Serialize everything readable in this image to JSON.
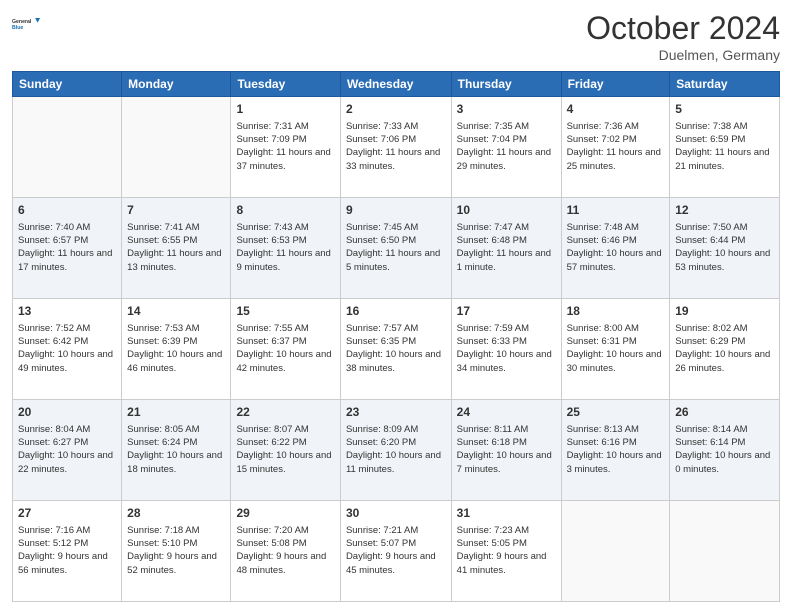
{
  "header": {
    "logo_line1": "General",
    "logo_line2": "Blue",
    "month": "October 2024",
    "location": "Duelmen, Germany"
  },
  "days_of_week": [
    "Sunday",
    "Monday",
    "Tuesday",
    "Wednesday",
    "Thursday",
    "Friday",
    "Saturday"
  ],
  "weeks": [
    [
      {
        "day": "",
        "info": ""
      },
      {
        "day": "",
        "info": ""
      },
      {
        "day": "1",
        "info": "Sunrise: 7:31 AM\nSunset: 7:09 PM\nDaylight: 11 hours and 37 minutes."
      },
      {
        "day": "2",
        "info": "Sunrise: 7:33 AM\nSunset: 7:06 PM\nDaylight: 11 hours and 33 minutes."
      },
      {
        "day": "3",
        "info": "Sunrise: 7:35 AM\nSunset: 7:04 PM\nDaylight: 11 hours and 29 minutes."
      },
      {
        "day": "4",
        "info": "Sunrise: 7:36 AM\nSunset: 7:02 PM\nDaylight: 11 hours and 25 minutes."
      },
      {
        "day": "5",
        "info": "Sunrise: 7:38 AM\nSunset: 6:59 PM\nDaylight: 11 hours and 21 minutes."
      }
    ],
    [
      {
        "day": "6",
        "info": "Sunrise: 7:40 AM\nSunset: 6:57 PM\nDaylight: 11 hours and 17 minutes."
      },
      {
        "day": "7",
        "info": "Sunrise: 7:41 AM\nSunset: 6:55 PM\nDaylight: 11 hours and 13 minutes."
      },
      {
        "day": "8",
        "info": "Sunrise: 7:43 AM\nSunset: 6:53 PM\nDaylight: 11 hours and 9 minutes."
      },
      {
        "day": "9",
        "info": "Sunrise: 7:45 AM\nSunset: 6:50 PM\nDaylight: 11 hours and 5 minutes."
      },
      {
        "day": "10",
        "info": "Sunrise: 7:47 AM\nSunset: 6:48 PM\nDaylight: 11 hours and 1 minute."
      },
      {
        "day": "11",
        "info": "Sunrise: 7:48 AM\nSunset: 6:46 PM\nDaylight: 10 hours and 57 minutes."
      },
      {
        "day": "12",
        "info": "Sunrise: 7:50 AM\nSunset: 6:44 PM\nDaylight: 10 hours and 53 minutes."
      }
    ],
    [
      {
        "day": "13",
        "info": "Sunrise: 7:52 AM\nSunset: 6:42 PM\nDaylight: 10 hours and 49 minutes."
      },
      {
        "day": "14",
        "info": "Sunrise: 7:53 AM\nSunset: 6:39 PM\nDaylight: 10 hours and 46 minutes."
      },
      {
        "day": "15",
        "info": "Sunrise: 7:55 AM\nSunset: 6:37 PM\nDaylight: 10 hours and 42 minutes."
      },
      {
        "day": "16",
        "info": "Sunrise: 7:57 AM\nSunset: 6:35 PM\nDaylight: 10 hours and 38 minutes."
      },
      {
        "day": "17",
        "info": "Sunrise: 7:59 AM\nSunset: 6:33 PM\nDaylight: 10 hours and 34 minutes."
      },
      {
        "day": "18",
        "info": "Sunrise: 8:00 AM\nSunset: 6:31 PM\nDaylight: 10 hours and 30 minutes."
      },
      {
        "day": "19",
        "info": "Sunrise: 8:02 AM\nSunset: 6:29 PM\nDaylight: 10 hours and 26 minutes."
      }
    ],
    [
      {
        "day": "20",
        "info": "Sunrise: 8:04 AM\nSunset: 6:27 PM\nDaylight: 10 hours and 22 minutes."
      },
      {
        "day": "21",
        "info": "Sunrise: 8:05 AM\nSunset: 6:24 PM\nDaylight: 10 hours and 18 minutes."
      },
      {
        "day": "22",
        "info": "Sunrise: 8:07 AM\nSunset: 6:22 PM\nDaylight: 10 hours and 15 minutes."
      },
      {
        "day": "23",
        "info": "Sunrise: 8:09 AM\nSunset: 6:20 PM\nDaylight: 10 hours and 11 minutes."
      },
      {
        "day": "24",
        "info": "Sunrise: 8:11 AM\nSunset: 6:18 PM\nDaylight: 10 hours and 7 minutes."
      },
      {
        "day": "25",
        "info": "Sunrise: 8:13 AM\nSunset: 6:16 PM\nDaylight: 10 hours and 3 minutes."
      },
      {
        "day": "26",
        "info": "Sunrise: 8:14 AM\nSunset: 6:14 PM\nDaylight: 10 hours and 0 minutes."
      }
    ],
    [
      {
        "day": "27",
        "info": "Sunrise: 7:16 AM\nSunset: 5:12 PM\nDaylight: 9 hours and 56 minutes."
      },
      {
        "day": "28",
        "info": "Sunrise: 7:18 AM\nSunset: 5:10 PM\nDaylight: 9 hours and 52 minutes."
      },
      {
        "day": "29",
        "info": "Sunrise: 7:20 AM\nSunset: 5:08 PM\nDaylight: 9 hours and 48 minutes."
      },
      {
        "day": "30",
        "info": "Sunrise: 7:21 AM\nSunset: 5:07 PM\nDaylight: 9 hours and 45 minutes."
      },
      {
        "day": "31",
        "info": "Sunrise: 7:23 AM\nSunset: 5:05 PM\nDaylight: 9 hours and 41 minutes."
      },
      {
        "day": "",
        "info": ""
      },
      {
        "day": "",
        "info": ""
      }
    ]
  ]
}
